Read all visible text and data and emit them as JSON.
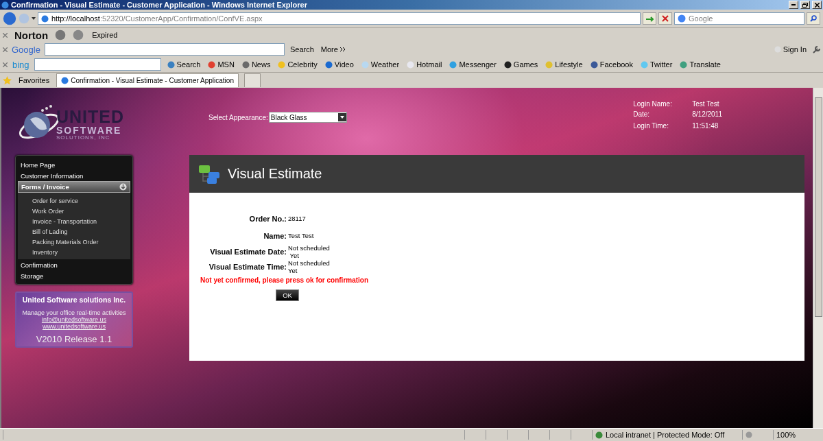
{
  "window": {
    "title": "Confirmation - Visual Estimate - Customer Application - Windows Internet Explorer"
  },
  "address_bar": {
    "url_host": "http://localhost",
    "url_rest": ":52320/CustomerApp/Confirmation/ConfVE.aspx"
  },
  "search_box": {
    "placeholder": "Google"
  },
  "norton_toolbar": {
    "logo": "Norton",
    "status": "Expired"
  },
  "google_toolbar": {
    "logo": "Google",
    "search_label": "Search",
    "more_label": "More",
    "sign_in": "Sign In"
  },
  "bing_toolbar": {
    "logo": "bing",
    "search_label": "Search",
    "links": [
      "MSN",
      "News",
      "Celebrity",
      "Video",
      "Weather",
      "Hotmail",
      "Messenger",
      "Games",
      "Lifestyle",
      "Facebook",
      "Twitter",
      "Translate"
    ]
  },
  "favorites": {
    "label": "Favorites",
    "tabs": [
      {
        "title": "Confirmation - Visual Estimate - Customer Application",
        "selected": true
      }
    ]
  },
  "logo": {
    "word": "UNITED",
    "sub": "SOFTWARE",
    "tagline": "SOLUTIONS, INC"
  },
  "appearance": {
    "label": "Select Appearance:",
    "value": "Black Glass"
  },
  "login_info": [
    {
      "label": "Login Name:",
      "value": "Test Test"
    },
    {
      "label": "Date:",
      "value": "8/12/2011"
    },
    {
      "label": "Login Time:",
      "value": "11:51:48"
    }
  ],
  "nav": [
    {
      "label": "Home Page",
      "selected": false
    },
    {
      "label": "Customer Information",
      "selected": false
    },
    {
      "label": "Forms / Invoice",
      "selected": true,
      "expanded": true,
      "children": [
        {
          "label": "Order for service"
        },
        {
          "label": "Work Order"
        },
        {
          "label": "Invoice - Transportation"
        },
        {
          "label": "Bill of Lading"
        },
        {
          "label": "Packing Materials Order"
        },
        {
          "label": "Inventory"
        }
      ]
    },
    {
      "label": "Confirmation",
      "selected": false
    },
    {
      "label": "Storage",
      "selected": false
    }
  ],
  "info_box": {
    "title": "United Software solutions Inc.",
    "tagline": "Manage your office real-time activities",
    "links": [
      "info@unitedsoftware.us",
      "www.unitedsoftware.us"
    ],
    "version": "V2010 Release 1.1"
  },
  "panel": {
    "title": "Visual Estimate",
    "fields": [
      {
        "label": "Order No.:",
        "lines": [
          "28117"
        ]
      },
      {
        "label": "Name:",
        "lines": [
          "Test Test"
        ]
      },
      {
        "label": "Visual Estimate Date:",
        "lines": [
          "Not scheduled",
          " Yet"
        ]
      },
      {
        "label": "Visual Estimate Time:",
        "lines": [
          "Not scheduled",
          "Yet"
        ]
      }
    ],
    "warning": "Not yet confirmed, please press ok for confirmation",
    "button": "OK"
  },
  "status_bar": {
    "zone": "Local intranet | Protected Mode: Off",
    "zoom": "100%"
  }
}
